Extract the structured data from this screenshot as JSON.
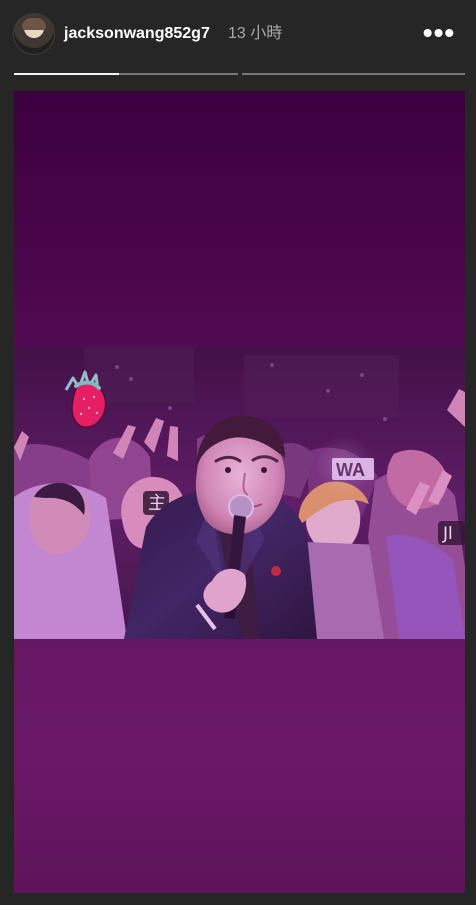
{
  "story": {
    "username": "jacksonwang852g7",
    "time_ago": "13 小時",
    "more_icon": "more-horizontal-icon",
    "progress": [
      0.47,
      0,
      0
    ],
    "colors": {
      "background": "#262626",
      "purple_top": "#3d003f",
      "purple_bottom": "#6c1869",
      "progress_active": "#f2f2f2",
      "progress_inactive": "#777777"
    }
  },
  "photo": {
    "sticker_icon": "strawberry-icon",
    "microphone_icon": "microphone-icon",
    "crowd_sign_text": "WA",
    "crowd_sign_text_2": "主",
    "crowd_sign_text_3": "Jl"
  }
}
